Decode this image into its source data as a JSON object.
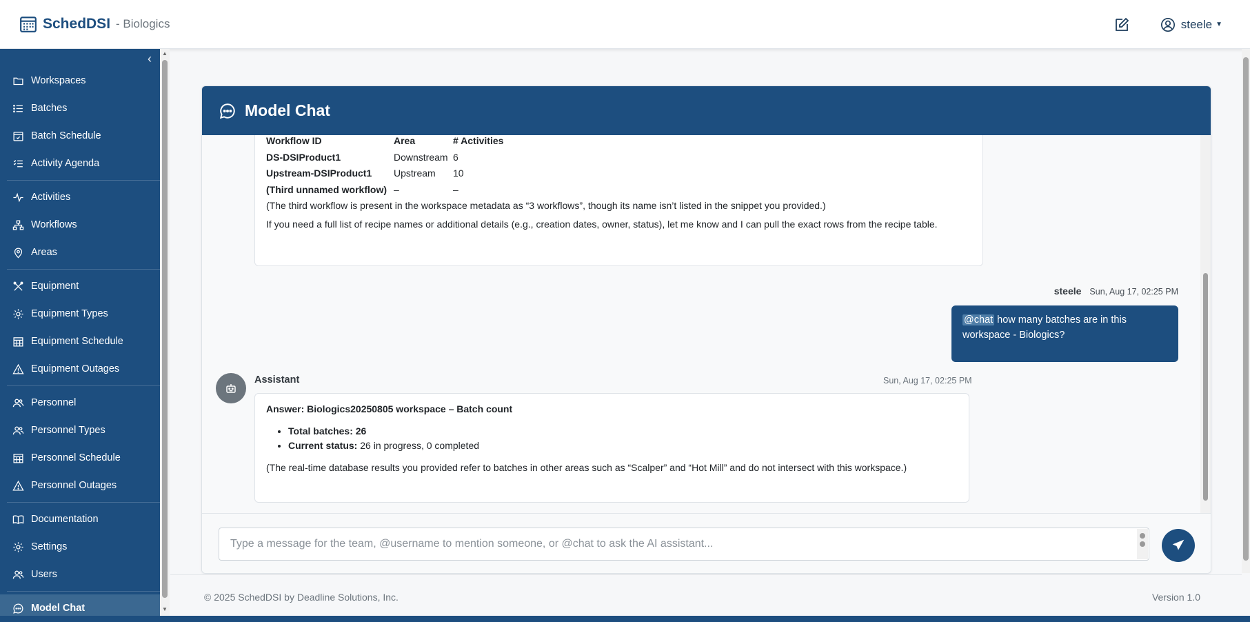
{
  "header": {
    "brand": "SchedDSI",
    "workspace": "- Biologics",
    "user": "steele"
  },
  "sidebar": {
    "items": [
      {
        "label": "Workspaces",
        "icon": "folder-icon"
      },
      {
        "label": "Batches",
        "icon": "list-icon"
      },
      {
        "label": "Batch Schedule",
        "icon": "calendar-icon"
      },
      {
        "label": "Activity Agenda",
        "icon": "checklist-icon"
      },
      {
        "label": "Activities",
        "icon": "pulse-icon"
      },
      {
        "label": "Workflows",
        "icon": "hierarchy-icon"
      },
      {
        "label": "Areas",
        "icon": "map-pin-icon"
      },
      {
        "label": "Equipment",
        "icon": "tools-icon"
      },
      {
        "label": "Equipment Types",
        "icon": "gear-icon"
      },
      {
        "label": "Equipment Schedule",
        "icon": "grid-calendar-icon"
      },
      {
        "label": "Equipment Outages",
        "icon": "warning-icon"
      },
      {
        "label": "Personnel",
        "icon": "people-icon"
      },
      {
        "label": "Personnel Types",
        "icon": "people-icon"
      },
      {
        "label": "Personnel Schedule",
        "icon": "grid-calendar-icon"
      },
      {
        "label": "Personnel Outages",
        "icon": "warning-icon"
      },
      {
        "label": "Documentation",
        "icon": "book-icon"
      },
      {
        "label": "Settings",
        "icon": "gear-icon"
      },
      {
        "label": "Users",
        "icon": "people-icon"
      },
      {
        "label": "Model Chat",
        "icon": "chat-icon"
      }
    ]
  },
  "chat": {
    "title": "Model Chat",
    "msg1": {
      "table_headers": [
        "Workflow ID",
        "Area",
        "# Activities"
      ],
      "rows": [
        [
          "DS-DSIProduct1",
          "Downstream",
          "6"
        ],
        [
          "Upstream-DSIProduct1",
          "Upstream",
          "10"
        ],
        [
          "(Third unnamed workflow)",
          "–",
          "–"
        ]
      ],
      "note": "(The third workflow is present in the workspace metadata as “3 workflows”, though its name isn’t listed in the snippet you provided.)",
      "followup": "If you need a full list of recipe names or additional details (e.g., creation dates, owner, status), let me know and I can pull the exact rows from the recipe table."
    },
    "user_msg": {
      "sender": "steele",
      "time": "Sun, Aug 17, 02:25 PM",
      "mention": "@chat",
      "text": " how many batches are in this workspace - Biologics?"
    },
    "assistant_msg": {
      "sender": "Assistant",
      "time": "Sun, Aug 17, 02:25 PM",
      "heading": "Answer: Biologics20250805 workspace – Batch count",
      "total_label": "Total batches: 26",
      "status_label": "Current status:",
      "status_value": " 26 in progress, 0 completed",
      "note": "(The real-time database results you provided refer to batches in other areas such as “Scalper” and “Hot Mill” and do not intersect with this workspace.)"
    },
    "input_placeholder": "Type a message for the team, @username to mention someone, or @chat to ask the AI assistant..."
  },
  "footer": {
    "copyright": "© 2025 SchedDSI by Deadline Solutions, Inc.",
    "version": "Version 1.0"
  }
}
